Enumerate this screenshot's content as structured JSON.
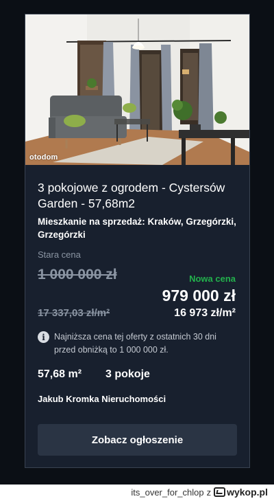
{
  "listing": {
    "photo_watermark": "otodom",
    "title": "3 pokojowe z ogrodem - Cystersów Garden - 57,68m2",
    "subtitle": "Mieszkanie na sprzedaż: Kraków, Grzegórzki, Grzegórzki",
    "old_price_label": "Stara cena",
    "old_price": "1 000 000 zł",
    "old_price_per_m2": "17 337,03 zł/m²",
    "new_price_label": "Nowa cena",
    "new_price": "979 000 zł",
    "new_price_per_m2": "16 973 zł/m²",
    "info_icon": "info-circle-icon",
    "info_text": "Najniższa cena tej oferty z ostatnich 30 dni przed obniżką to 1 000 000 zł.",
    "area": "57,68 m²",
    "rooms": "3 pokoje",
    "agency": "Jakub Kromka Nieruchomości",
    "cta_label": "Zobacz ogłoszenie"
  },
  "footer": {
    "author": "its_over_for_chlop",
    "connector": "z",
    "site": "wykop.pl"
  },
  "colors": {
    "page_bg": "#0b0f15",
    "card_bg": "#18202e",
    "new_price_accent": "#22b14c",
    "muted_text": "#8b95a3",
    "button_bg": "#2a3444"
  }
}
